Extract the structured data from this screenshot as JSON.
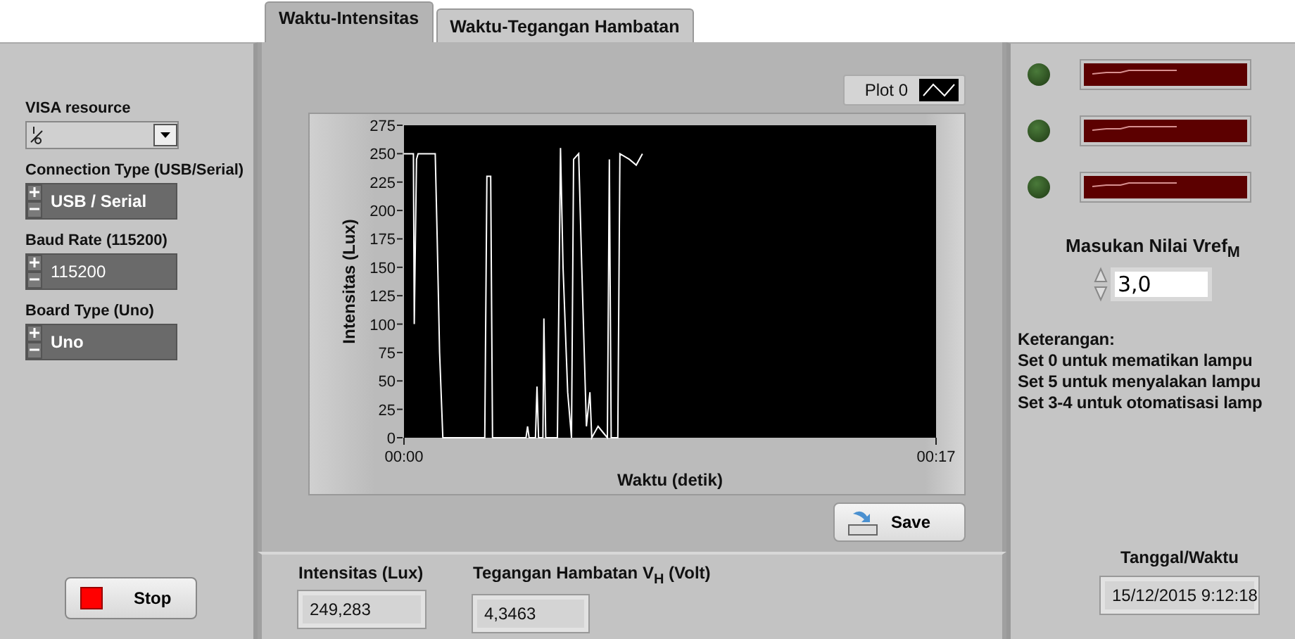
{
  "tabs": [
    {
      "label": "Waktu-Intensitas",
      "selected": true
    },
    {
      "label": "Waktu-Tegangan Hambatan",
      "selected": false
    }
  ],
  "settings": [
    {
      "kind": "visa",
      "label": "VISA resource"
    },
    {
      "kind": "ring",
      "label": "Connection Type (USB/Serial)",
      "value": "USB / Serial"
    },
    {
      "kind": "numeric",
      "label": "Baud Rate (115200)",
      "value": "115200"
    },
    {
      "kind": "ring",
      "label": "Board Type (Uno)",
      "value": "Uno"
    }
  ],
  "stop_button": {
    "label": "Stop"
  },
  "graph": {
    "chart_data": {
      "type": "line",
      "xlabel": "Waktu (detik)",
      "ylabel": "Intensitas (Lux)",
      "xlim": [
        0,
        17
      ],
      "ylim": [
        0,
        275
      ],
      "xticks": [
        {
          "value": 0,
          "label": "00:00"
        },
        {
          "value": 17,
          "label": "00:17"
        }
      ],
      "yticks": [
        0,
        25,
        50,
        75,
        100,
        125,
        150,
        175,
        200,
        225,
        250,
        275
      ],
      "x": [
        0,
        0.3,
        0.33,
        0.4,
        0.45,
        1.0,
        1.06,
        1.14,
        1.24,
        2.58,
        2.65,
        2.77,
        2.83,
        3.9,
        3.95,
        4.0,
        4.2,
        4.25,
        4.3,
        4.44,
        4.47,
        4.53,
        4.9,
        5.0,
        5.08,
        5.23,
        5.35,
        5.42,
        5.58,
        5.68,
        5.83,
        5.94,
        6.0,
        6.2,
        6.35,
        6.5,
        6.56,
        6.62,
        6.83,
        6.9,
        7.2,
        7.42,
        7.62
      ],
      "series": [
        {
          "name": "Plot 0",
          "color": "#ffffff",
          "values": [
            250,
            250,
            100,
            245,
            250,
            250,
            175,
            75,
            0,
            0,
            230,
            230,
            0,
            0,
            10,
            0,
            0,
            45,
            0,
            0,
            105,
            0,
            0,
            255,
            150,
            40,
            0,
            245,
            250,
            150,
            10,
            40,
            0,
            10,
            5,
            0,
            245,
            0,
            0,
            250,
            245,
            240,
            250
          ]
        }
      ]
    }
  },
  "save_button": {
    "label": "Save"
  },
  "readouts": [
    {
      "label": "Intensitas (Lux)",
      "value": "249,283"
    },
    {
      "label": "Tegangan Hambatan V$_{H}$ (Volt)",
      "value": "4,3463"
    }
  ],
  "lamps": [
    {
      "on": false
    },
    {
      "on": false
    },
    {
      "on": false
    }
  ],
  "vref": {
    "label": "Masukan Nilai Vref$_{M}$",
    "value": "3,0"
  },
  "notes": {
    "title": "Keterangan:",
    "lines": [
      "Set 0 untuk mematikan lampu",
      "Set 5 untuk menyalakan lampu",
      "Set 3-4 untuk otomatisasi lamp"
    ]
  },
  "datetime": {
    "label": "Tanggal/Waktu",
    "value": "15/12/2015 9:12:18"
  }
}
